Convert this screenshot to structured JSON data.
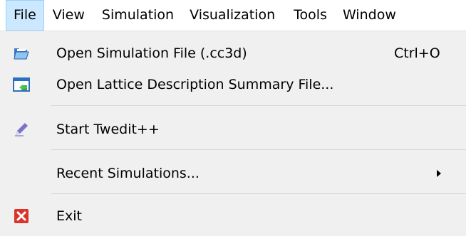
{
  "menubar": {
    "items": [
      {
        "label": "File",
        "active": true
      },
      {
        "label": "View"
      },
      {
        "label": "Simulation"
      },
      {
        "label": "Visualization"
      },
      {
        "label": "Tools"
      },
      {
        "label": "Window"
      }
    ]
  },
  "file_menu": {
    "items": [
      {
        "label": "Open Simulation File (.cc3d)",
        "shortcut": "Ctrl+O",
        "icon": "folder-open-icon"
      },
      {
        "label": "Open Lattice Description Summary File...",
        "icon": "lattice-file-icon"
      },
      {
        "label": "Start Twedit++",
        "icon": "twedit-pen-icon"
      },
      {
        "label": "Recent Simulations...",
        "has_submenu": true
      },
      {
        "label": "Exit",
        "icon": "exit-x-icon"
      }
    ]
  },
  "colors": {
    "menubar_bg": "#ffffff",
    "menu_bg": "#f0f0f0",
    "active_bg": "#cce8ff",
    "active_border": "#99d1ff",
    "separator": "#d7d7d7",
    "exit_red": "#d9352c"
  }
}
